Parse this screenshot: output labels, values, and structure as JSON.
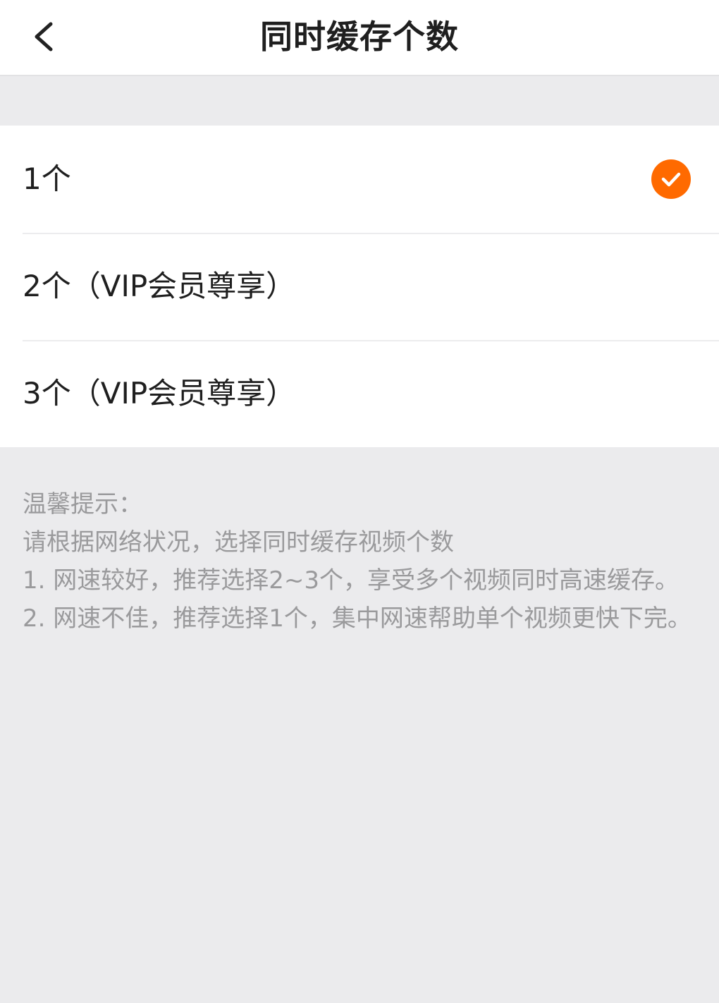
{
  "header": {
    "title": "同时缓存个数",
    "back_icon": "chevron-left-icon"
  },
  "options": [
    {
      "label": "1个",
      "selected": true
    },
    {
      "label": "2个（VIP会员尊享）",
      "selected": false
    },
    {
      "label": "3个（VIP会员尊享）",
      "selected": false
    }
  ],
  "selected_icon": "check-circle-icon",
  "accent_color": "#ff6a00",
  "tips": {
    "heading": "温馨提示：",
    "line1": "请根据网络状况，选择同时缓存视频个数",
    "line2": "1. 网速较好，推荐选择2~3个，享受多个视频同时高速缓存。",
    "line3": "2. 网速不佳，推荐选择1个，集中网速帮助单个视频更快下完。"
  }
}
